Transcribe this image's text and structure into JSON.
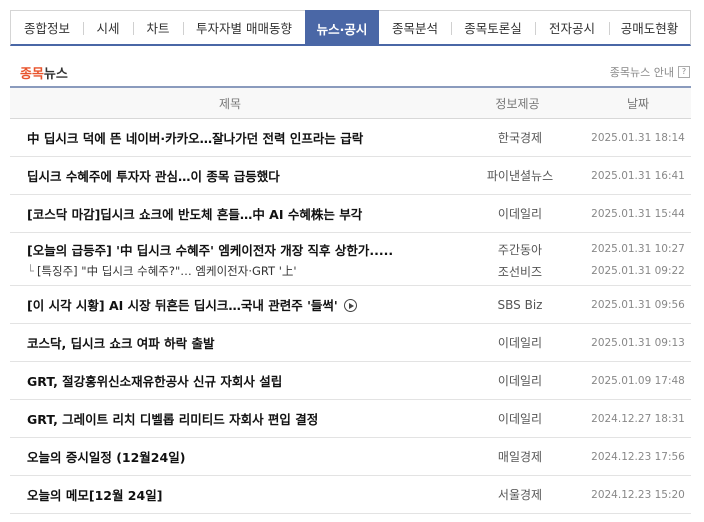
{
  "tabs": [
    {
      "label": "종합정보"
    },
    {
      "label": "시세"
    },
    {
      "label": "차트"
    },
    {
      "label": "투자자별 매매동향"
    },
    {
      "label": "뉴스·공시",
      "active": true
    },
    {
      "label": "종목분석"
    },
    {
      "label": "종목토론실"
    },
    {
      "label": "전자공시"
    },
    {
      "label": "공매도현황"
    }
  ],
  "section": {
    "title_accent": "종목",
    "title_rest": "뉴스",
    "guide": "종목뉴스 안내",
    "guide_icon": "?"
  },
  "table": {
    "headers": {
      "title": "제목",
      "source": "정보제공",
      "date": "날짜"
    },
    "rows": [
      {
        "title": "中 딥시크 덕에 뜬 네이버·카카오…잘나가던 전력 인프라는 급락",
        "source": "한국경제",
        "date": "2025.01.31 18:14"
      },
      {
        "title": "딥시크 수혜주에 투자자 관심…이 종목 급등했다",
        "source": "파이낸셜뉴스",
        "date": "2025.01.31 16:41"
      },
      {
        "title": "[코스닥 마감]딥시크 쇼크에 반도체 흔들…中 AI 수혜株는 부각",
        "source": "이데일리",
        "date": "2025.01.31 15:44"
      },
      {
        "title": "[오늘의 급등주] '中 딥시크 수혜주' 엠케이전자 개장 직후 상한가.....",
        "source": "주간동아",
        "date": "2025.01.31 10:27",
        "related": {
          "tree": "└",
          "title": "[특징주] \"中 딥시크 수혜주?\"… 엠케이전자·GRT '上'",
          "source": "조선비즈",
          "date": "2025.01.31 09:22"
        }
      },
      {
        "title": "[이 시각 시황] AI 시장 뒤흔든 딥시크…국내 관련주 '들썩'",
        "source": "SBS Biz",
        "date": "2025.01.31 09:56",
        "video": true
      },
      {
        "title": "코스닥, 딥시크 쇼크 여파 하락 출발",
        "source": "이데일리",
        "date": "2025.01.31 09:13"
      },
      {
        "title": "GRT, 절강홍위신소재유한공사 신규 자회사 설립",
        "source": "이데일리",
        "date": "2025.01.09 17:48"
      },
      {
        "title": "GRT, 그레이트 리치 디벨롭 리미티드 자회사 편입 결정",
        "source": "이데일리",
        "date": "2024.12.27 18:31"
      },
      {
        "title": "오늘의 증시일정 (12월24일)",
        "source": "매일경제",
        "date": "2024.12.23 17:56"
      },
      {
        "title": "오늘의 메모[12월 24일]",
        "source": "서울경제",
        "date": "2024.12.23 15:20"
      }
    ]
  },
  "colors": {
    "tab_active": "#4a67a6",
    "accent": "#e8542c"
  }
}
